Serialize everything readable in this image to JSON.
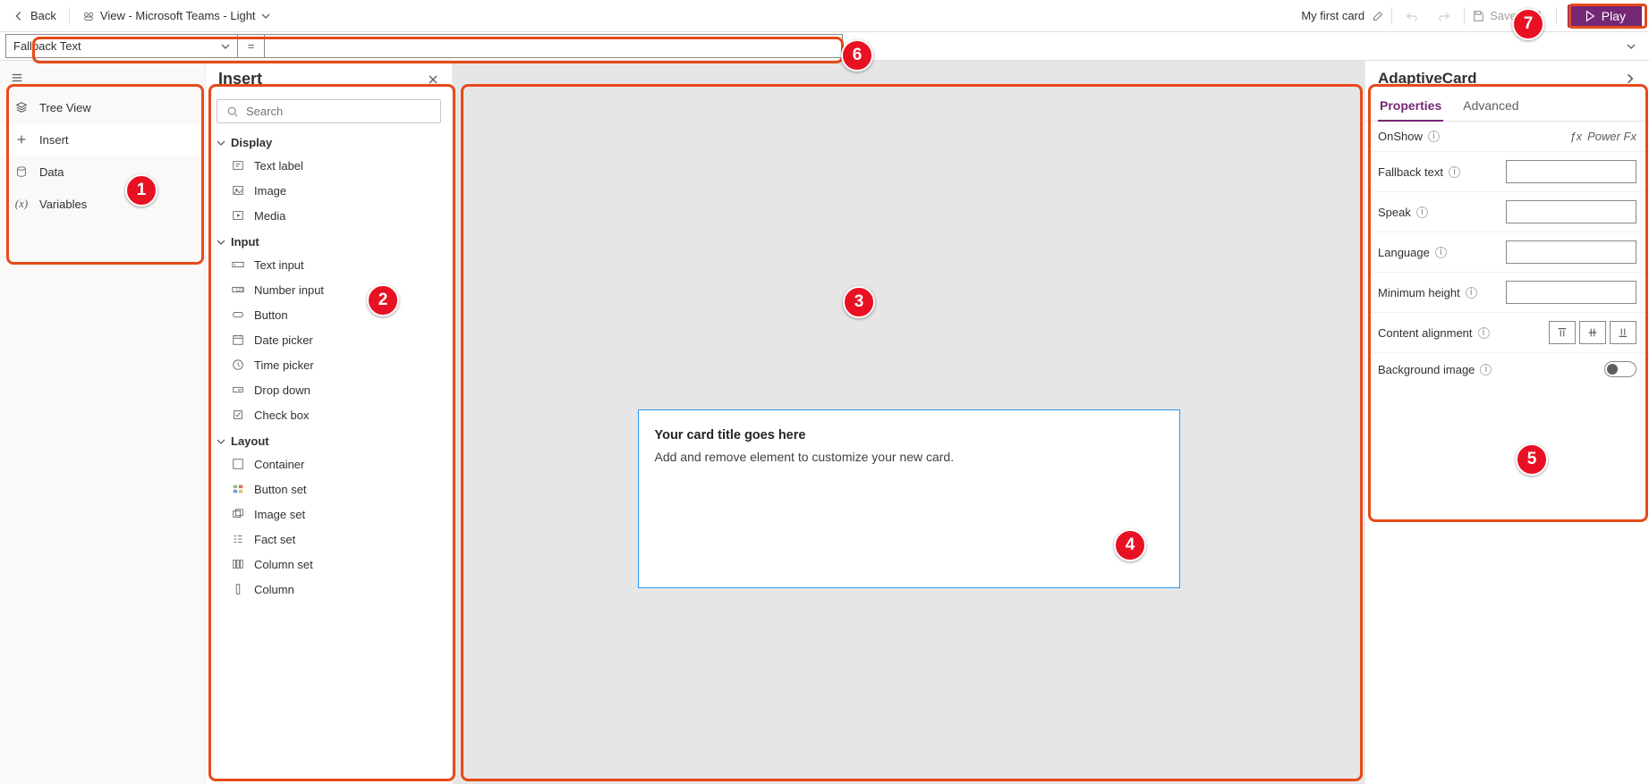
{
  "toolbar": {
    "back": "Back",
    "view_label": "View - Microsoft Teams - Light",
    "card_name": "My first card",
    "save": "Save",
    "play": "Play"
  },
  "formula": {
    "property": "Fallback Text",
    "eq": "=",
    "value": ""
  },
  "left_rail": {
    "items": [
      {
        "label": "Tree View"
      },
      {
        "label": "Insert"
      },
      {
        "label": "Data"
      },
      {
        "label": "Variables"
      }
    ]
  },
  "insert_panel": {
    "title": "Insert",
    "search_placeholder": "Search",
    "categories": [
      {
        "name": "Display",
        "items": [
          "Text label",
          "Image",
          "Media"
        ]
      },
      {
        "name": "Input",
        "items": [
          "Text input",
          "Number input",
          "Button",
          "Date picker",
          "Time picker",
          "Drop down",
          "Check box"
        ]
      },
      {
        "name": "Layout",
        "items": [
          "Container",
          "Button set",
          "Image set",
          "Fact set",
          "Column set",
          "Column"
        ]
      }
    ]
  },
  "canvas": {
    "card_title": "Your card title goes here",
    "card_body": "Add and remove element to customize your new card."
  },
  "props": {
    "header": "AdaptiveCard",
    "tabs": [
      "Properties",
      "Advanced"
    ],
    "rows": {
      "onshow": "OnShow",
      "onshow_fx": "Power Fx",
      "fallback": "Fallback text",
      "speak": "Speak",
      "language": "Language",
      "minheight": "Minimum height",
      "contentalign": "Content alignment",
      "bgimage": "Background image"
    }
  },
  "annotations": [
    "1",
    "2",
    "3",
    "4",
    "5",
    "6",
    "7"
  ]
}
